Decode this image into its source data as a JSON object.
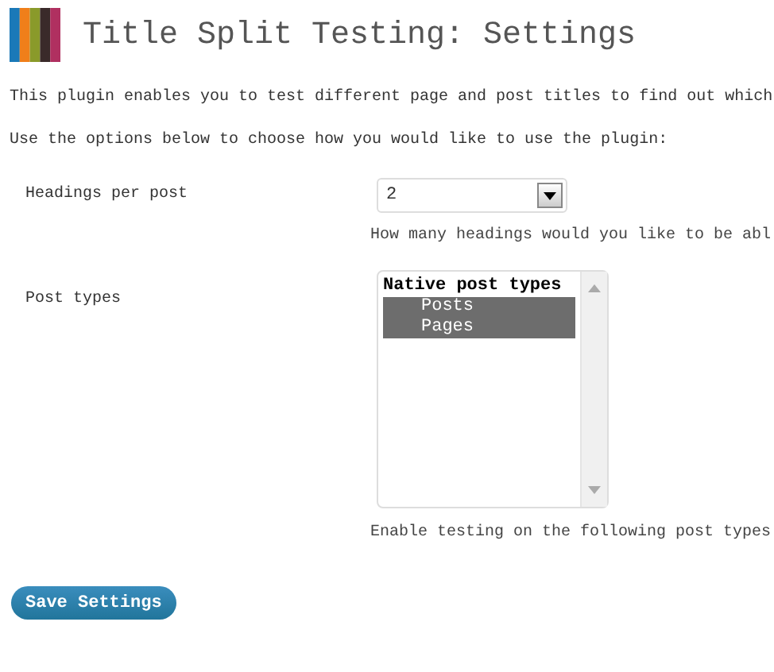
{
  "header": {
    "title": "Title Split Testing: Settings"
  },
  "intro": [
    "This plugin enables you to test different page and post titles to find out which",
    "Use the options below to choose how you would like to use the plugin:"
  ],
  "headings_per_post": {
    "label": "Headings per post",
    "value": "2",
    "hint": "How many headings would you like to be abl"
  },
  "post_types": {
    "label": "Post types",
    "group": "Native post types",
    "options": [
      {
        "label": "Posts",
        "selected": true
      },
      {
        "label": "Pages",
        "selected": true
      }
    ],
    "hint": "Enable testing on the following post types"
  },
  "save_button": "Save Settings"
}
